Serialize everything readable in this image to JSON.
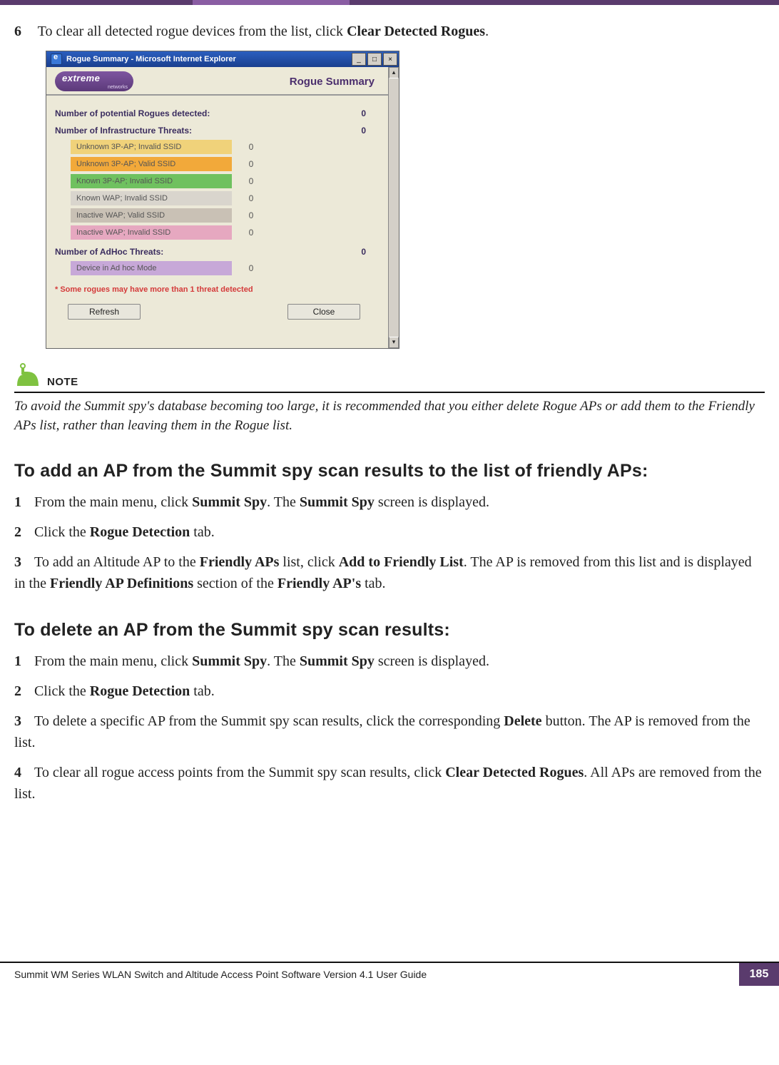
{
  "step6": {
    "num": "6",
    "pre": "To clear all detected rogue devices from the list, click ",
    "bold": "Clear Detected Rogues",
    "post": "."
  },
  "dialog": {
    "title": "Rogue Summary - Microsoft Internet Explorer",
    "logo": {
      "brand": "extreme",
      "sub": "networks"
    },
    "page_title": "Rogue Summary",
    "stat1": {
      "label": "Number of potential Rogues detected:",
      "value": "0"
    },
    "stat2": {
      "label": "Number of Infrastructure Threats:",
      "value": "0"
    },
    "threats": [
      {
        "label": "Unknown 3P-AP; Invalid SSID",
        "value": "0",
        "color": "#f0d27a"
      },
      {
        "label": "Unknown 3P-AP; Valid SSID",
        "value": "0",
        "color": "#f2a93a"
      },
      {
        "label": "Known 3P-AP; Invalid SSID",
        "value": "0",
        "color": "#6fc15f"
      },
      {
        "label": "Known WAP; Invalid SSID",
        "value": "0",
        "color": "#d9d5cd"
      },
      {
        "label": "Inactive WAP; Valid SSID",
        "value": "0",
        "color": "#c9c1b5"
      },
      {
        "label": "Inactive WAP; Invalid SSID",
        "value": "0",
        "color": "#e6a8c0"
      }
    ],
    "stat3": {
      "label": "Number of AdHoc Threats:",
      "value": "0"
    },
    "adhoc": {
      "label": "Device in Ad hoc Mode",
      "value": "0",
      "color": "#c7a8d8"
    },
    "footnote": "* Some rogues may have more than 1 threat detected",
    "refresh": "Refresh",
    "close": "Close"
  },
  "note": {
    "label": "NOTE",
    "text": "To avoid the Summit spy's database becoming too large, it is recommended that you either delete Rogue APs or add them to the Friendly APs list, rather than leaving them in the Rogue list."
  },
  "sectionA": {
    "heading": "To add an AP from the Summit spy scan results to the list of friendly APs:",
    "steps": [
      {
        "num": "1",
        "segs": [
          {
            "t": "From the main menu, click "
          },
          {
            "b": "Summit Spy"
          },
          {
            "t": ". The "
          },
          {
            "b": "Summit Spy"
          },
          {
            "t": " screen is displayed."
          }
        ]
      },
      {
        "num": "2",
        "segs": [
          {
            "t": "Click the "
          },
          {
            "b": "Rogue Detection"
          },
          {
            "t": " tab."
          }
        ]
      },
      {
        "num": "3",
        "segs": [
          {
            "t": "To add an Altitude AP to the "
          },
          {
            "b": "Friendly APs"
          },
          {
            "t": " list, click "
          },
          {
            "b": "Add to Friendly List"
          },
          {
            "t": ". The AP is removed from this list and is displayed in the "
          },
          {
            "b": "Friendly AP Definitions"
          },
          {
            "t": " section of the "
          },
          {
            "b": "Friendly AP's"
          },
          {
            "t": " tab."
          }
        ]
      }
    ]
  },
  "sectionB": {
    "heading": "To delete an AP from the Summit spy scan results:",
    "steps": [
      {
        "num": "1",
        "segs": [
          {
            "t": "From the main menu, click "
          },
          {
            "b": "Summit Spy"
          },
          {
            "t": ". The "
          },
          {
            "b": "Summit Spy"
          },
          {
            "t": " screen is displayed."
          }
        ]
      },
      {
        "num": "2",
        "segs": [
          {
            "t": "Click the "
          },
          {
            "b": "Rogue Detection"
          },
          {
            "t": " tab."
          }
        ]
      },
      {
        "num": "3",
        "segs": [
          {
            "t": "To delete a specific AP from the Summit spy scan results, click the corresponding "
          },
          {
            "b": "Delete"
          },
          {
            "t": " button. The AP is removed from the list."
          }
        ]
      },
      {
        "num": "4",
        "segs": [
          {
            "t": "To clear all rogue access points from the Summit spy scan results, click "
          },
          {
            "b": "Clear Detected Rogues"
          },
          {
            "t": ". All APs are removed from the list."
          }
        ]
      }
    ]
  },
  "footer": {
    "text": "Summit WM Series WLAN Switch and Altitude Access Point Software Version 4.1 User Guide",
    "page": "185"
  }
}
